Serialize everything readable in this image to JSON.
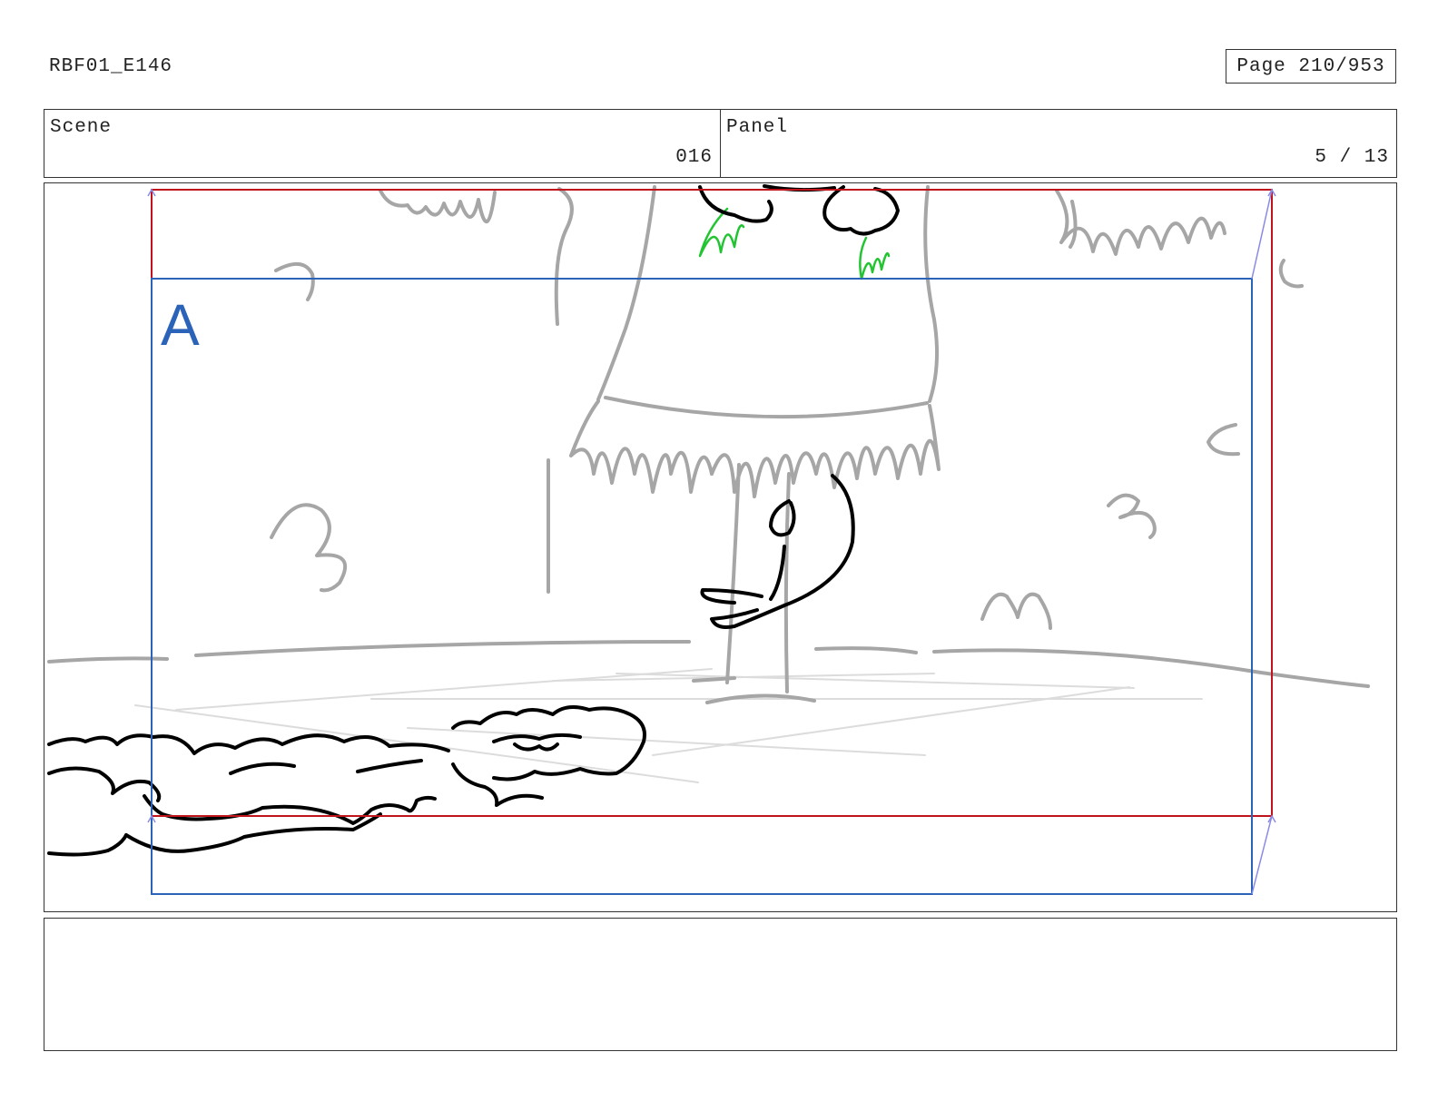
{
  "header": {
    "doc_id": "RBF01_E146",
    "page_label": "Page 210/953"
  },
  "info": {
    "scene_label": "Scene",
    "scene_value": "016",
    "panel_label": "Panel",
    "panel_value": "5 / 13"
  },
  "camera": {
    "field_label": "A",
    "colors": {
      "outer_frame": "#c0141c",
      "inner_frame": "#2a63b8",
      "move_arrows": "#8a8ae6"
    }
  },
  "sketch": {
    "colors": {
      "ink": "#000000",
      "rough": "#a6a6a6",
      "faint": "#dcdcdc",
      "accent": "#22c432"
    }
  },
  "notes": {
    "text": ""
  }
}
